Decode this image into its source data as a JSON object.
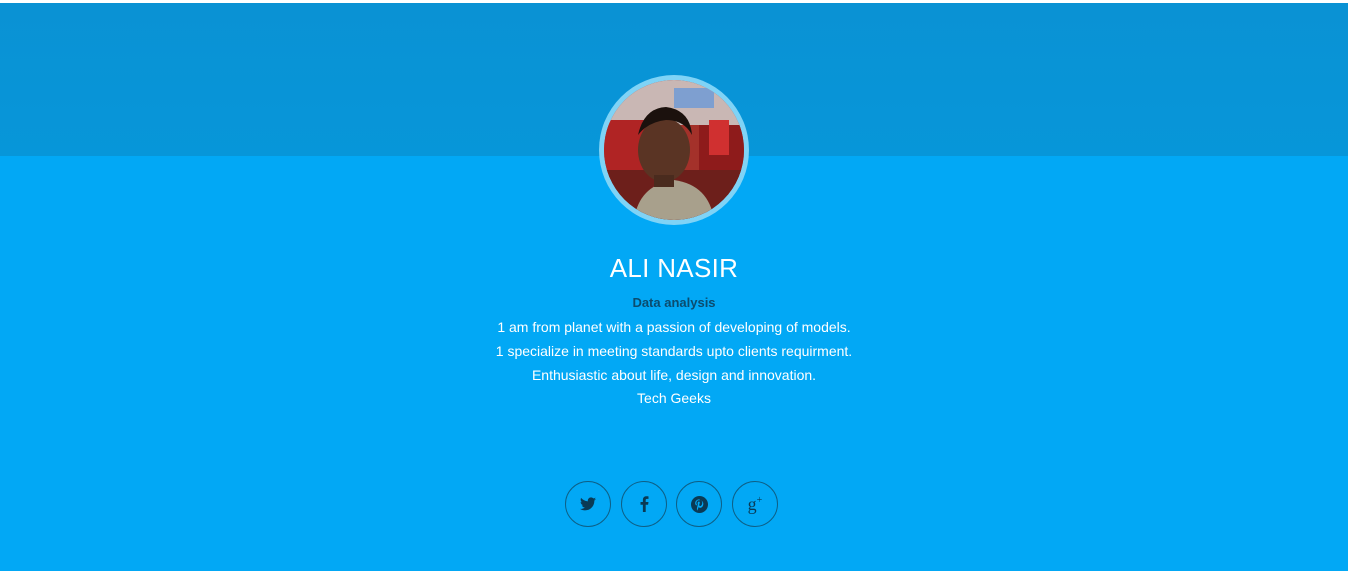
{
  "profile": {
    "name": "ALI NASIR",
    "role": "Data analysis",
    "bio": [
      "1 am from planet with a passion of developing of models.",
      "1 specialize in meeting standards upto clients requirment.",
      "Enthusiastic about life, design and innovation.",
      "Tech Geeks"
    ]
  },
  "social": [
    {
      "icon": "twitter-icon"
    },
    {
      "icon": "facebook-icon"
    },
    {
      "icon": "pinterest-icon"
    },
    {
      "icon": "google-plus-icon"
    }
  ],
  "colors": {
    "header_band": "#0796d9",
    "hero_bg": "#02a8f5",
    "avatar_ring": "#7fd3f6",
    "name_text": "#ffffff",
    "role_text": "#0b4c6e",
    "icon_border": "#0e5f86"
  }
}
